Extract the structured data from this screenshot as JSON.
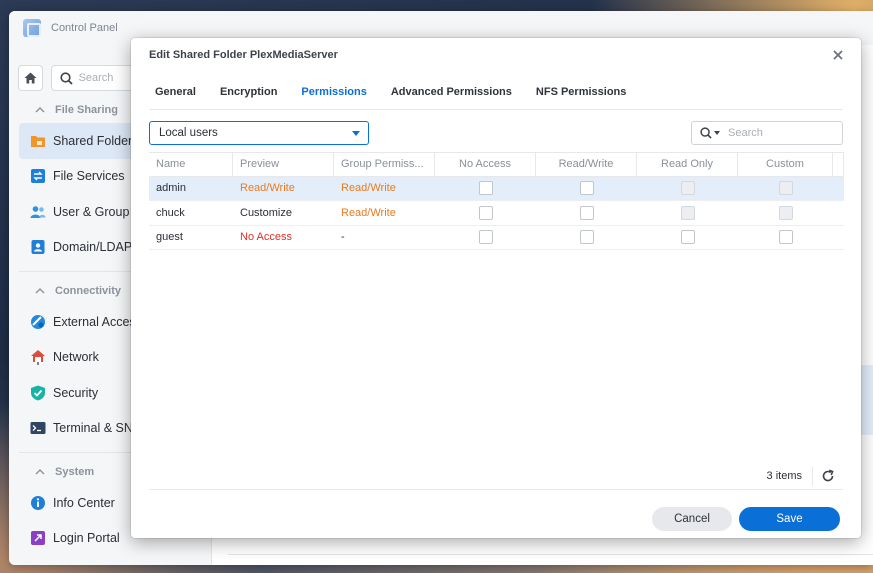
{
  "control_panel": {
    "title": "Control Panel",
    "search_placeholder": "Search",
    "sections": [
      {
        "label": "File Sharing",
        "items": [
          "Shared Folder",
          "File Services",
          "User & Group",
          "Domain/LDAP"
        ]
      },
      {
        "label": "Connectivity",
        "items": [
          "External Access",
          "Network",
          "Security",
          "Terminal & SNMP"
        ]
      },
      {
        "label": "System",
        "items": [
          "Info Center",
          "Login Portal"
        ]
      }
    ]
  },
  "dialog": {
    "title": "Edit Shared Folder PlexMediaServer",
    "tabs": [
      "General",
      "Encryption",
      "Permissions",
      "Advanced Permissions",
      "NFS Permissions"
    ],
    "active_tab": "Permissions",
    "user_filter": "Local users",
    "search_placeholder": "Search",
    "columns": [
      "Name",
      "Preview",
      "Group Permiss...",
      "No Access",
      "Read/Write",
      "Read Only",
      "Custom"
    ],
    "rows": [
      {
        "name": "admin",
        "preview": "Read/Write",
        "group": "Read/Write"
      },
      {
        "name": "chuck",
        "preview": "Customize",
        "group": "Read/Write"
      },
      {
        "name": "guest",
        "preview": "No Access",
        "group": "-"
      }
    ],
    "items_count": "3 items",
    "cancel_label": "Cancel",
    "save_label": "Save"
  },
  "colors": {
    "accent": "#0a6fd6",
    "orange": "#ec7a1c",
    "red": "#e0312a"
  }
}
